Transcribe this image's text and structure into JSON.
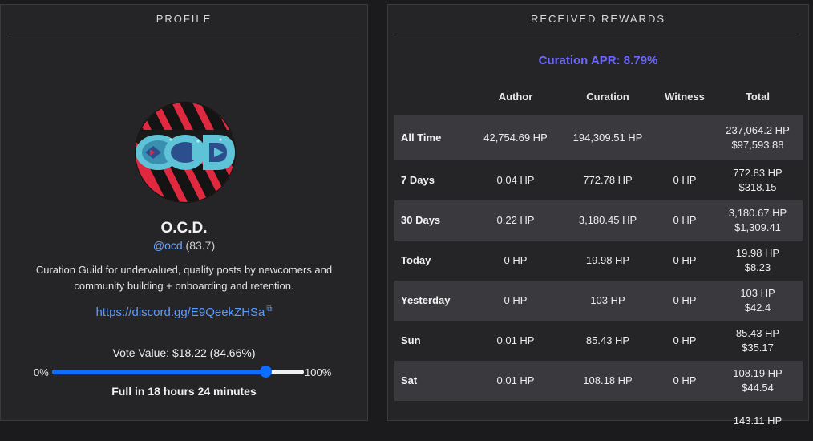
{
  "profile": {
    "header": "PROFILE",
    "name": "O.C.D.",
    "handle": "@ocd",
    "reputation": "(83.7)",
    "bio_line1": "Curation Guild for undervalued, quality posts by newcomers and",
    "bio_line2": "community building + onboarding and retention.",
    "link": "https://discord.gg/E9QeekZHSa",
    "vote_value": "Vote Value: $18.22 (84.66%)",
    "slider_min": "0%",
    "slider_max": "100%",
    "slider_fraction": 0.8466,
    "full_in": "Full in 18 hours 24 minutes"
  },
  "rewards": {
    "header": "RECEIVED REWARDS",
    "apr": "Curation APR: 8.79%",
    "columns": [
      "Author",
      "Curation",
      "Witness",
      "Total"
    ],
    "rows": [
      {
        "label": "All Time",
        "author": "42,754.69 HP",
        "curation": "194,309.51 HP",
        "witness": "",
        "total_hp": "237,064.2 HP",
        "total_usd": "$97,593.88"
      },
      {
        "label": "7 Days",
        "author": "0.04 HP",
        "curation": "772.78 HP",
        "witness": "0 HP",
        "total_hp": "772.83 HP",
        "total_usd": "$318.15"
      },
      {
        "label": "30 Days",
        "author": "0.22 HP",
        "curation": "3,180.45 HP",
        "witness": "0 HP",
        "total_hp": "3,180.67 HP",
        "total_usd": "$1,309.41"
      },
      {
        "label": "Today",
        "author": "0 HP",
        "curation": "19.98 HP",
        "witness": "0 HP",
        "total_hp": "19.98 HP",
        "total_usd": "$8.23"
      },
      {
        "label": "Yesterday",
        "author": "0 HP",
        "curation": "103 HP",
        "witness": "0 HP",
        "total_hp": "103 HP",
        "total_usd": "$42.4"
      },
      {
        "label": "Sun",
        "author": "0.01 HP",
        "curation": "85.43 HP",
        "witness": "0 HP",
        "total_hp": "85.43 HP",
        "total_usd": "$35.17"
      },
      {
        "label": "Sat",
        "author": "0.01 HP",
        "curation": "108.18 HP",
        "witness": "0 HP",
        "total_hp": "108.19 HP",
        "total_usd": "$44.54"
      },
      {
        "label": "",
        "author": "",
        "curation": "",
        "witness": "",
        "total_hp": "143.11 HP",
        "total_usd": ""
      }
    ]
  },
  "colors": {
    "accent_blue": "#0d6efd",
    "link_blue": "#5b9cff",
    "apr_purple": "#6d67ff",
    "avatar_red": "#e0283f",
    "avatar_teal": "#5ec3d6"
  },
  "icons": [
    "ocd-avatar-logo",
    "external-link-icon"
  ]
}
